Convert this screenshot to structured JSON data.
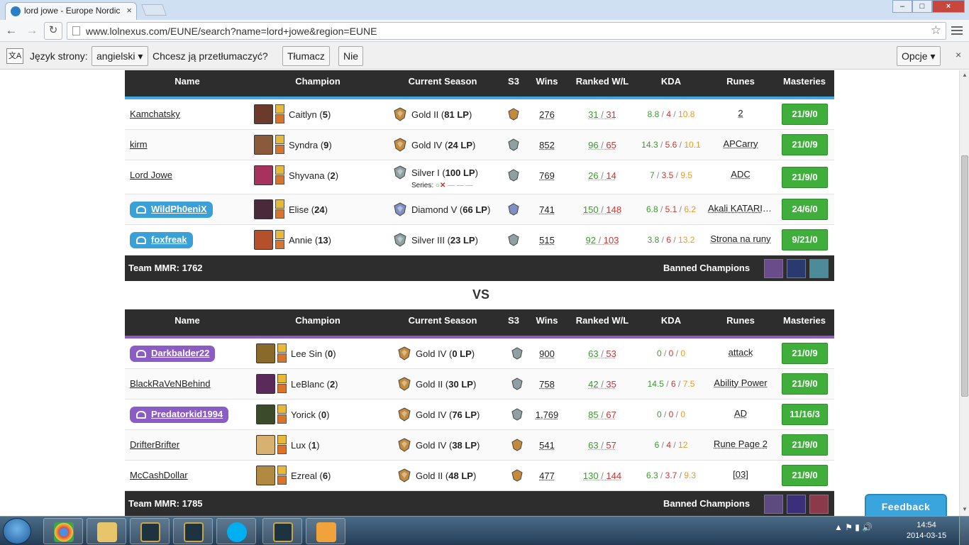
{
  "browser": {
    "tab_title": "lord jowe - Europe Nordic",
    "url": "www.lolnexus.com/EUNE/search?name=lord+jowe&region=EUNE"
  },
  "translate_bar": {
    "language_label": "Język strony:",
    "language_value": "angielski",
    "question": "Chcesz ją przetłumaczyć?",
    "translate_button": "Tłumacz",
    "no_button": "Nie",
    "options_button": "Opcje"
  },
  "columns": [
    "Name",
    "Champion",
    "Current Season",
    "S3",
    "Wins",
    "Ranked W/L",
    "KDA",
    "Runes",
    "Masteries"
  ],
  "vs_label": "VS",
  "footer": {
    "mmr_label": "Team MMR:",
    "banned_label": "Banned Champions"
  },
  "teams": [
    {
      "accent_color": "#3ea7e3",
      "mmr": "1762",
      "players": [
        {
          "name": "Kamchatsky",
          "pill": false,
          "champion": "Caitlyn",
          "champ_games": "5",
          "tier": "Gold II",
          "lp": "81 LP",
          "tier_color": "#c28a3a",
          "s3_color": "#c28a3a",
          "series": false,
          "wins": "276",
          "w": "31",
          "l": "31",
          "k": "8.8",
          "d": "4",
          "a": "10.8",
          "runes": "2",
          "masteries": "21/9/0"
        },
        {
          "name": "kirm",
          "pill": false,
          "champion": "Syndra",
          "champ_games": "9",
          "tier": "Gold IV",
          "lp": "24 LP",
          "tier_color": "#c28a3a",
          "s3_color": "#8fa0a3",
          "series": false,
          "wins": "852",
          "w": "96",
          "l": "65",
          "k": "14.3",
          "d": "5.6",
          "a": "10.1",
          "runes": "APCarry",
          "masteries": "21/0/9"
        },
        {
          "name": "Lord Jowe",
          "pill": false,
          "champion": "Shyvana",
          "champ_games": "2",
          "tier": "Silver I",
          "lp": "100 LP",
          "tier_color": "#8fa0a3",
          "s3_color": "#8fa0a3",
          "series": true,
          "series_label": "Series:",
          "wins": "769",
          "w": "26",
          "l": "14",
          "k": "7",
          "d": "3.5",
          "a": "9.5",
          "runes": "ADC",
          "masteries": "21/9/0"
        },
        {
          "name": "WildPh0eniX",
          "pill": true,
          "pill_color": "#3aa1d8",
          "champion": "Elise",
          "champ_games": "24",
          "tier": "Diamond V",
          "lp": "66 LP",
          "tier_color": "#7f8fc4",
          "s3_color": "#7f8fc4",
          "series": false,
          "wins": "741",
          "w": "150",
          "l": "148",
          "k": "6.8",
          "d": "5.1",
          "a": "6.2",
          "runes": "Akali KATARINA",
          "masteries": "24/6/0"
        },
        {
          "name": "foxfreak",
          "pill": true,
          "pill_color": "#3aa1d8",
          "champion": "Annie",
          "champ_games": "13",
          "tier": "Silver III",
          "lp": "23 LP",
          "tier_color": "#8fa0a3",
          "s3_color": "#8fa0a3",
          "series": false,
          "wins": "515",
          "w": "92",
          "l": "103",
          "k": "3.8",
          "d": "6",
          "a": "13.2",
          "runes": "Strona na runy",
          "masteries": "9/21/0"
        }
      ],
      "bans": [
        "#6a4c8a",
        "#2a3a6e",
        "#4d8a9a"
      ]
    },
    {
      "accent_color": "#8a5cc4",
      "mmr": "1785",
      "players": [
        {
          "name": "Darkbalder22",
          "pill": true,
          "pill_color": "#8a5cc4",
          "champion": "Lee Sin",
          "champ_games": "0",
          "tier": "Gold IV",
          "lp": "0 LP",
          "tier_color": "#c28a3a",
          "s3_color": "#8fa0a3",
          "series": false,
          "wins": "900",
          "w": "63",
          "l": "53",
          "k": "0",
          "d": "0",
          "a": "0",
          "runes": "attack",
          "masteries": "21/0/9"
        },
        {
          "name": "BlackRaVeNBehind",
          "pill": false,
          "champion": "LeBlanc",
          "champ_games": "2",
          "tier": "Gold II",
          "lp": "30 LP",
          "tier_color": "#c28a3a",
          "s3_color": "#8fa0a3",
          "series": false,
          "wins": "758",
          "w": "42",
          "l": "35",
          "k": "14.5",
          "d": "6",
          "a": "7.5",
          "runes": "Ability Power",
          "masteries": "21/9/0"
        },
        {
          "name": "Predatorkid1994",
          "pill": true,
          "pill_color": "#8a5cc4",
          "champion": "Yorick",
          "champ_games": "0",
          "tier": "Gold IV",
          "lp": "76 LP",
          "tier_color": "#c28a3a",
          "s3_color": "#8fa0a3",
          "series": false,
          "wins": "1,769",
          "w": "85",
          "l": "67",
          "k": "0",
          "d": "0",
          "a": "0",
          "runes": "AD",
          "masteries": "11/16/3"
        },
        {
          "name": "DrifterBrifter",
          "pill": false,
          "champion": "Lux",
          "champ_games": "1",
          "tier": "Gold IV",
          "lp": "38 LP",
          "tier_color": "#c28a3a",
          "s3_color": "#c28a3a",
          "series": false,
          "wins": "541",
          "w": "63",
          "l": "57",
          "k": "6",
          "d": "4",
          "a": "12",
          "runes": "Rune Page 2",
          "masteries": "21/9/0"
        },
        {
          "name": "McCashDollar",
          "pill": false,
          "champion": "Ezreal",
          "champ_games": "6",
          "tier": "Gold II",
          "lp": "48 LP",
          "tier_color": "#c28a3a",
          "s3_color": "#c28a3a",
          "series": false,
          "wins": "477",
          "w": "130",
          "l": "144",
          "k": "6.3",
          "d": "3.7",
          "a": "9.3",
          "runes": "[03]",
          "masteries": "21/9/0"
        }
      ],
      "bans": [
        "#5d4a7e",
        "#3b2f7a",
        "#8a3a4a"
      ]
    }
  ],
  "feedback_label": "Feedback",
  "taskbar": {
    "time": "14:54",
    "date": "2014-03-15"
  }
}
